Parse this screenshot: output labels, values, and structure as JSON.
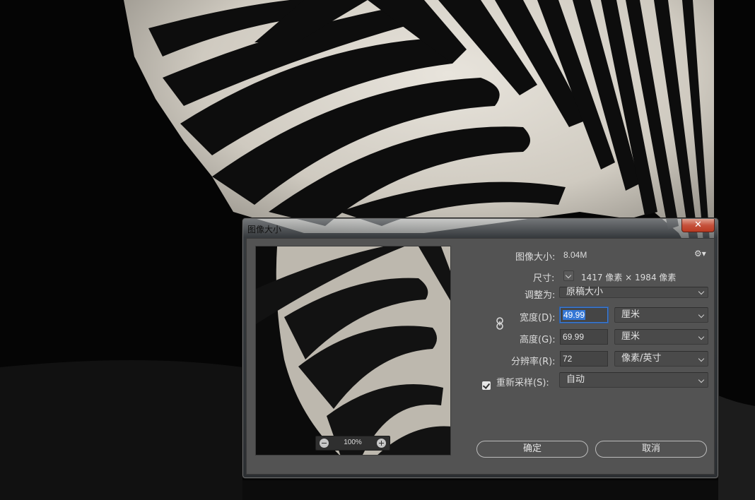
{
  "dialog": {
    "title": "图像大小",
    "close_label": "✕",
    "image_size_label": "图像大小:",
    "image_size_value": "8.04M",
    "dimensions_label": "尺寸:",
    "dimensions_value": "1417 像素 × 1984 像素",
    "fit_to_label": "调整为:",
    "fit_to_value": "原稿大小",
    "width_label": "宽度(D):",
    "width_value": "49.99",
    "width_unit": "厘米",
    "height_label": "高度(G):",
    "height_value": "69.99",
    "height_unit": "厘米",
    "resolution_label": "分辨率(R):",
    "resolution_value": "72",
    "resolution_unit": "像素/英寸",
    "resample_label": "重新采样(S):",
    "resample_checked": true,
    "resample_value": "自动",
    "ok_label": "确定",
    "cancel_label": "取消"
  },
  "preview": {
    "zoom": "100%"
  },
  "icons": {
    "gear": "gear-icon",
    "link": "chain-link-icon",
    "zoom_out": "minus-circle-icon",
    "zoom_in": "plus-circle-icon"
  },
  "colors": {
    "dialog_bg": "#535353",
    "focus_border": "#3e7bd2",
    "close_button": "#c6523c"
  }
}
